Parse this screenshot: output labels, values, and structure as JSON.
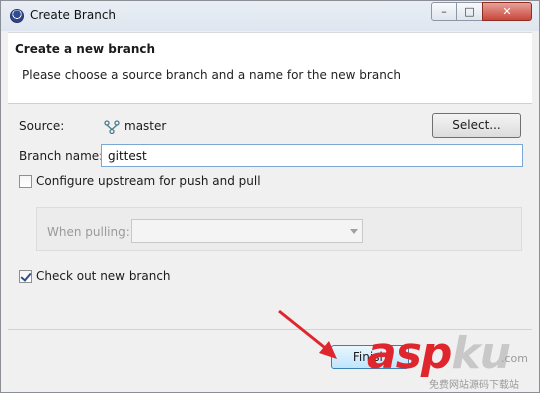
{
  "window": {
    "title": "Create Branch",
    "controls": {
      "minimize": "–",
      "maximize": "□",
      "close": "✕"
    }
  },
  "banner": {
    "title": "Create a new branch",
    "message": "Please choose a source branch and a name for the new branch"
  },
  "source": {
    "label": "Source:",
    "value": "master",
    "icon": "git-branch-icon",
    "select_button": "Select..."
  },
  "branch_name": {
    "label": "Branch name:",
    "value": "gittest"
  },
  "configure_upstream": {
    "label": "Configure upstream for push and pull",
    "checked": false
  },
  "when_pulling": {
    "label": "When pulling:",
    "value": "",
    "enabled": false
  },
  "checkout": {
    "label": "Check out new branch",
    "checked": true
  },
  "buttons": {
    "finish": "Finish"
  },
  "watermark": {
    "brand_main": "asp",
    "brand_accent": "ku",
    "domain_suffix": ".com",
    "subtitle": "免费网站源码下载站"
  },
  "colors": {
    "accent": "#3c7fb1",
    "close": "#c8473b",
    "arrow": "#e0262d"
  }
}
